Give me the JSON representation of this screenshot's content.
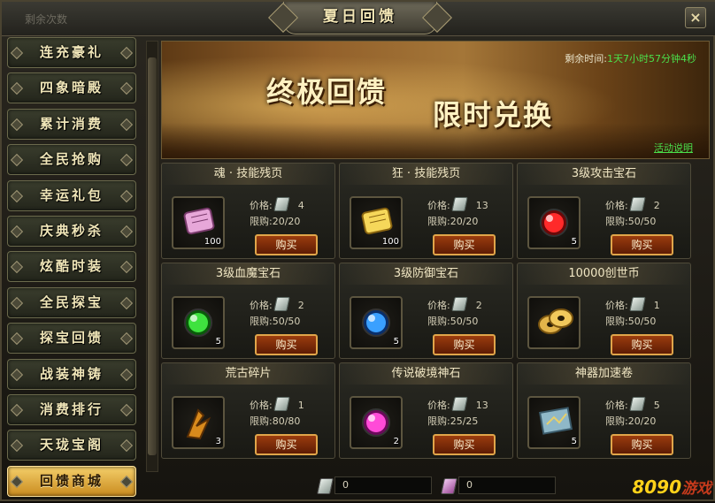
{
  "window": {
    "title": "夏日回馈",
    "top_left_text": "剩余次数",
    "close_label": "×"
  },
  "sidebar": {
    "items": [
      {
        "label": "连充豪礼",
        "active": false
      },
      {
        "label": "四象暗殿",
        "active": false
      },
      {
        "label": "累计消费",
        "active": false
      },
      {
        "label": "全民抢购",
        "active": false
      },
      {
        "label": "幸运礼包",
        "active": false
      },
      {
        "label": "庆典秒杀",
        "active": false
      },
      {
        "label": "炫酷时装",
        "active": false
      },
      {
        "label": "全民探宝",
        "active": false
      },
      {
        "label": "探宝回馈",
        "active": false
      },
      {
        "label": "战装神铸",
        "active": false
      },
      {
        "label": "消费排行",
        "active": false
      },
      {
        "label": "天珑宝阁",
        "active": false
      },
      {
        "label": "回馈商城",
        "active": true
      }
    ]
  },
  "banner": {
    "title_1": "终极回馈",
    "title_2": "限时兑换",
    "timer_label": "剩余时间:",
    "timer_value": "1天7小时57分钟4秒",
    "rules_link": "活动说明"
  },
  "shop": {
    "price_label": "价格:",
    "limit_label": "限购:",
    "buy_label": "购买",
    "items": [
      {
        "name": "魂 · 技能残页",
        "icon": "scroll-purple",
        "qty": "100",
        "price": "4",
        "limit": "20/20"
      },
      {
        "name": "狂 · 技能残页",
        "icon": "scroll-gold",
        "qty": "100",
        "price": "13",
        "limit": "20/20"
      },
      {
        "name": "3级攻击宝石",
        "icon": "gem-red",
        "qty": "5",
        "price": "2",
        "limit": "50/50"
      },
      {
        "name": "3级血魔宝石",
        "icon": "gem-green",
        "qty": "5",
        "price": "2",
        "limit": "50/50"
      },
      {
        "name": "3级防御宝石",
        "icon": "gem-blue",
        "qty": "5",
        "price": "2",
        "limit": "50/50"
      },
      {
        "name": "10000创世币",
        "icon": "coin",
        "qty": "",
        "price": "1",
        "limit": "50/50"
      },
      {
        "name": "荒古碎片",
        "icon": "fragment",
        "qty": "3",
        "price": "1",
        "limit": "80/80"
      },
      {
        "name": "传说破境神石",
        "icon": "gem-magenta",
        "qty": "2",
        "price": "13",
        "limit": "25/25"
      },
      {
        "name": "神器加速卷",
        "icon": "map-scroll",
        "qty": "5",
        "price": "5",
        "limit": "20/20"
      }
    ]
  },
  "currency": {
    "ticket_silver_amount": "0",
    "ticket_purple_amount": "0"
  },
  "watermark": {
    "text_1": "8090",
    "text_2": "游戏"
  },
  "colors": {
    "accent_gold": "#f4cf6a",
    "timer_green": "#4be04b",
    "buy_button": "#9b3c0e"
  }
}
